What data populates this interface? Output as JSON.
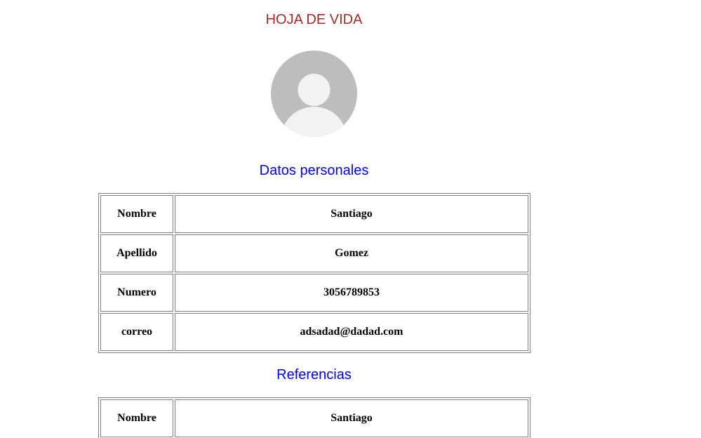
{
  "page": {
    "title": "HOJA DE VIDA"
  },
  "avatar": {
    "icon": "user-silhouette-icon",
    "bg_color": "#bdbdbd",
    "figure_color": "#f2f2f2"
  },
  "datos_personales": {
    "heading": "Datos personales",
    "rows": [
      {
        "label": "Nombre",
        "value": "Santiago"
      },
      {
        "label": "Apellido",
        "value": "Gomez"
      },
      {
        "label": "Numero",
        "value": "3056789853"
      },
      {
        "label": "correo",
        "value": "adsadad@dadad.com"
      }
    ]
  },
  "referencias": {
    "heading": "Referencias",
    "rows": [
      {
        "label": "Nombre",
        "value": "Santiago"
      }
    ]
  },
  "colors": {
    "title": "#a52a2a",
    "section_heading": "#0000ee",
    "table_border": "#808080"
  }
}
